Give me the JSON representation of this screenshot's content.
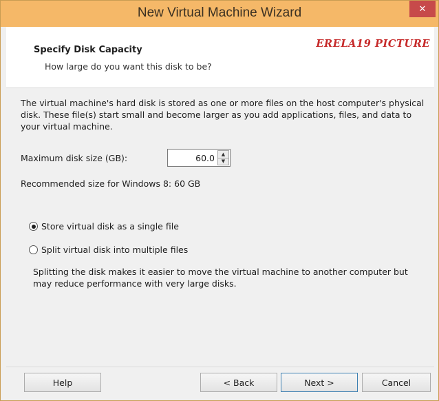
{
  "window": {
    "title": "New Virtual Machine Wizard",
    "close_glyph": "✕"
  },
  "header": {
    "title": "Specify Disk Capacity",
    "subtitle": "How large do you want this disk to be?",
    "watermark": "ERELA19 PICTURE"
  },
  "content": {
    "description": "The virtual machine's hard disk is stored as one or more files on the host computer's physical disk. These file(s) start small and become larger as you add applications, files, and data to your virtual machine.",
    "max_disk_label": "Maximum disk size (GB):",
    "max_disk_value": "60.0",
    "recommended": "Recommended size for Windows 8: 60 GB",
    "options": [
      {
        "label": "Store virtual disk as a single file",
        "selected": true
      },
      {
        "label": "Split virtual disk into multiple files",
        "selected": false
      }
    ],
    "split_description": "Splitting the disk makes it easier to move the virtual machine to another computer but may reduce performance with very large disks."
  },
  "footer": {
    "help_label": "Help",
    "back_label": "< Back",
    "next_label": "Next >",
    "cancel_label": "Cancel"
  },
  "colors": {
    "titlebar": "#f5b868",
    "close": "#c74a4a",
    "watermark": "#c62a2a",
    "default_button_border": "#3c7fb1"
  },
  "icons": {
    "close": "close-icon",
    "spin_up": "spin-up-icon",
    "spin_down": "spin-down-icon"
  }
}
